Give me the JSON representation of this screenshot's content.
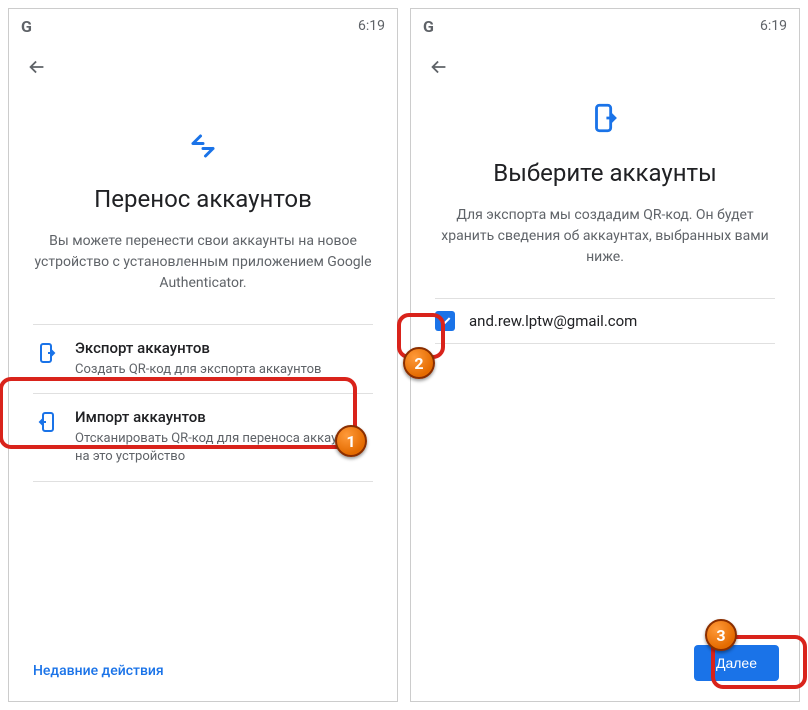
{
  "statusbar": {
    "logo": "G",
    "time": "6:19"
  },
  "left": {
    "title": "Перенос аккаунтов",
    "subtitle": "Вы можете перенести свои аккаунты на новое устройство с установленным приложением Google Authenticator.",
    "export": {
      "title": "Экспорт аккаунтов",
      "desc": "Создать QR-код для экспорта аккаунтов"
    },
    "import": {
      "title": "Импорт аккаунтов",
      "desc": "Отсканировать QR-код для переноса аккаунтов на это устройство"
    },
    "recent": "Недавние действия"
  },
  "right": {
    "title": "Выберите аккаунты",
    "subtitle": "Для экспорта мы создадим QR-код. Он будет хранить сведения об аккаунтах, выбранных вами ниже.",
    "account_email": "and.rew.lptw@gmail.com",
    "next": "Далее"
  },
  "annotations": {
    "b1": "1",
    "b2": "2",
    "b3": "3"
  }
}
